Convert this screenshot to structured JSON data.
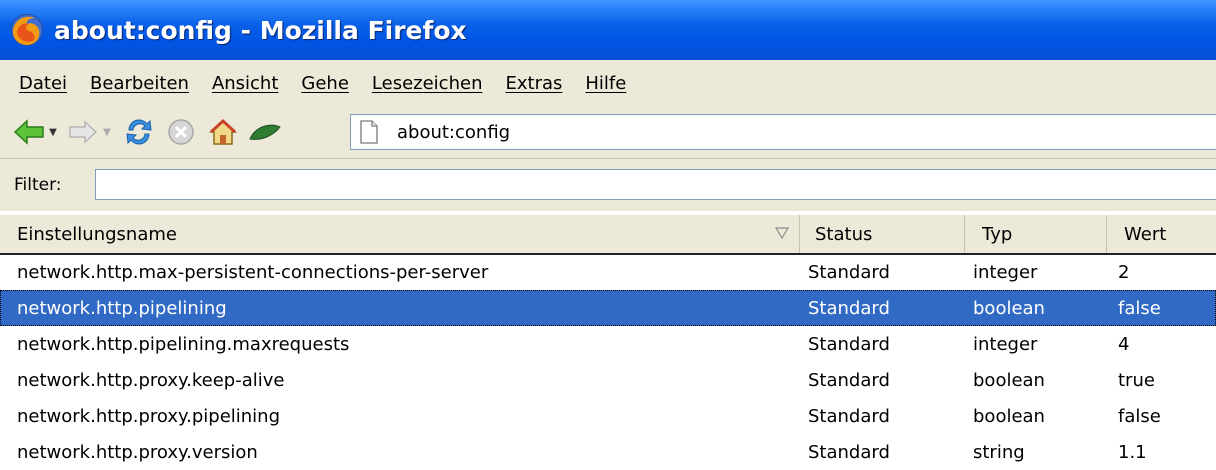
{
  "window": {
    "title": "about:config - Mozilla Firefox"
  },
  "menu": [
    "Datei",
    "Bearbeiten",
    "Ansicht",
    "Gehe",
    "Lesezeichen",
    "Extras",
    "Hilfe"
  ],
  "toolbar": {
    "url": "about:config"
  },
  "filter": {
    "label": "Filter:",
    "value": ""
  },
  "table": {
    "columns": [
      "Einstellungsname",
      "Status",
      "Typ",
      "Wert"
    ],
    "rows": [
      {
        "name": "network.http.max-persistent-connections-per-server",
        "status": "Standard",
        "type": "integer",
        "value": "2"
      },
      {
        "name": "network.http.pipelining",
        "status": "Standard",
        "type": "boolean",
        "value": "false",
        "selected": true
      },
      {
        "name": "network.http.pipelining.maxrequests",
        "status": "Standard",
        "type": "integer",
        "value": "4"
      },
      {
        "name": "network.http.proxy.keep-alive",
        "status": "Standard",
        "type": "boolean",
        "value": "true"
      },
      {
        "name": "network.http.proxy.pipelining",
        "status": "Standard",
        "type": "boolean",
        "value": "false"
      },
      {
        "name": "network.http.proxy.version",
        "status": "Standard",
        "type": "string",
        "value": "1.1"
      }
    ]
  },
  "colors": {
    "titlebar": "#0055e5",
    "chrome": "#ece9d8",
    "selection": "#316ac5"
  }
}
